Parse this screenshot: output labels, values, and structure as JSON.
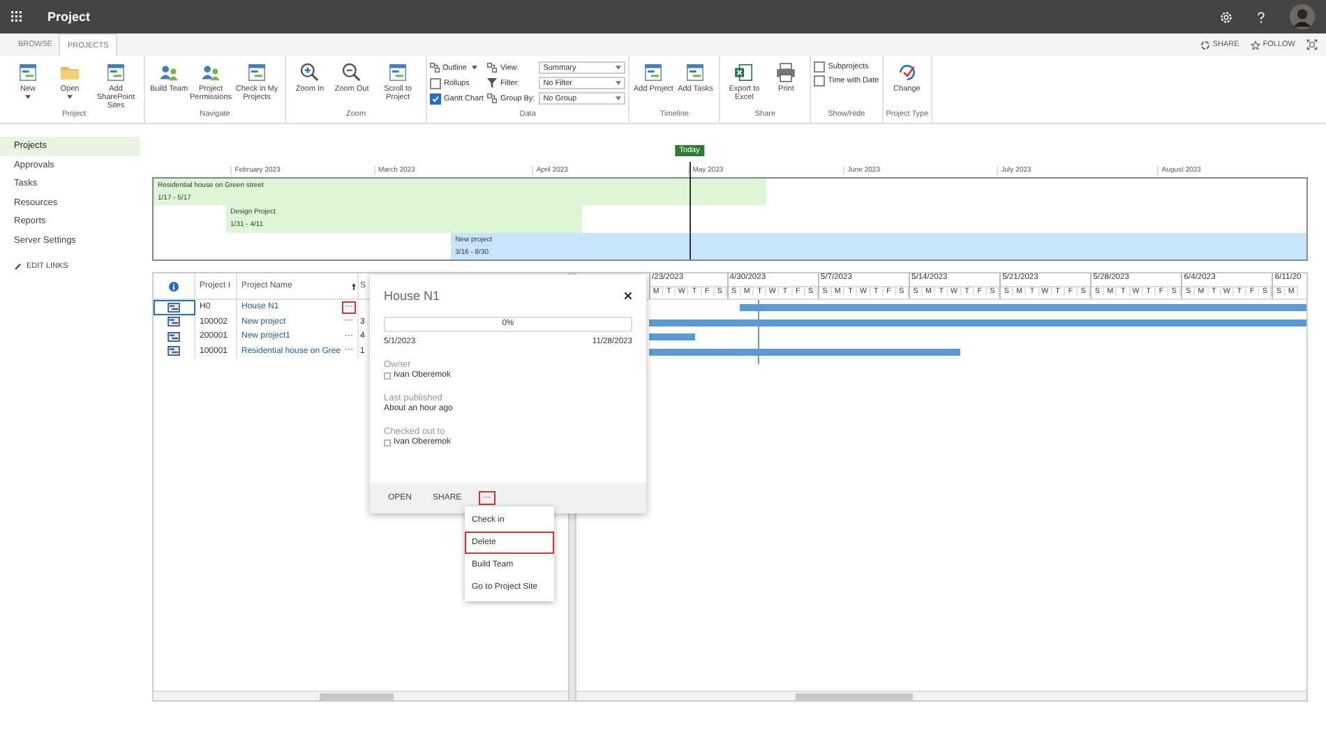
{
  "topbar": {
    "app_title": "Project"
  },
  "tabs": [
    {
      "label": "BROWSE",
      "selected": false
    },
    {
      "label": "PROJECTS",
      "selected": true
    }
  ],
  "page_actions": [
    {
      "label": "SHARE"
    },
    {
      "label": "FOLLOW"
    }
  ],
  "ribbon": {
    "groups": [
      {
        "label": "Project",
        "items": [
          {
            "kind": "large",
            "label": "New",
            "dropdown": true
          },
          {
            "kind": "large",
            "label": "Open",
            "dropdown": true
          },
          {
            "kind": "large",
            "label": "Add SharePoint Sites",
            "dropdown": false
          }
        ]
      },
      {
        "label": "Navigate",
        "items": [
          {
            "kind": "large",
            "label": "Build Team",
            "dropdown": false
          },
          {
            "kind": "large",
            "label": "Project Permissions",
            "dropdown": false
          },
          {
            "kind": "large",
            "label": "Check in My Projects",
            "dropdown": false
          }
        ]
      },
      {
        "label": "Zoom",
        "items": [
          {
            "kind": "large",
            "label": "Zoom In",
            "dropdown": false
          },
          {
            "kind": "large",
            "label": "Zoom Out",
            "dropdown": false
          },
          {
            "kind": "large",
            "label": "Scroll to Project",
            "dropdown": false
          }
        ]
      },
      {
        "label": "Data",
        "rows": [
          [
            {
              "kind": "small",
              "label": "Outline",
              "dropdown": true
            },
            {
              "kind": "small",
              "label": "View:",
              "dropdown": false
            },
            {
              "kind": "select",
              "value": "Summary"
            }
          ],
          [
            {
              "kind": "check",
              "label": "Rollups",
              "checked": false
            },
            {
              "kind": "small",
              "label": "Filter:",
              "dropdown": false
            },
            {
              "kind": "select",
              "value": "No Filter"
            }
          ],
          [
            {
              "kind": "check",
              "label": "Gantt Chart",
              "checked": true
            },
            {
              "kind": "small",
              "label": "Group By:",
              "dropdown": false
            },
            {
              "kind": "select",
              "value": "No Group"
            }
          ]
        ]
      },
      {
        "label": "Timeline",
        "items": [
          {
            "kind": "large",
            "label": "Add Project",
            "dropdown": false
          },
          {
            "kind": "large",
            "label": "Add Tasks",
            "dropdown": false
          }
        ]
      },
      {
        "label": "Share",
        "items": [
          {
            "kind": "large",
            "label": "Export to Excel",
            "dropdown": false
          },
          {
            "kind": "large",
            "label": "Print",
            "dropdown": false
          }
        ]
      },
      {
        "label": "Show/Hide",
        "rows": [
          [
            {
              "kind": "check",
              "label": "Subprojects",
              "checked": false
            }
          ],
          [
            {
              "kind": "check",
              "label": "Time with Date",
              "checked": false
            }
          ]
        ]
      },
      {
        "label": "Project Type",
        "items": [
          {
            "kind": "large",
            "label": "Change",
            "dropdown": false
          }
        ]
      }
    ]
  },
  "nav": {
    "items": [
      {
        "label": "Projects",
        "selected": true
      },
      {
        "label": "Approvals",
        "selected": false
      },
      {
        "label": "Tasks",
        "selected": false
      },
      {
        "label": "Resources",
        "selected": false
      },
      {
        "label": "Reports",
        "selected": false
      },
      {
        "label": "Server Settings",
        "selected": false
      }
    ],
    "edit_links": "EDIT LINKS"
  },
  "timeline": {
    "today_label": "Today",
    "months": [
      "February 2023",
      "March 2023",
      "April 2023",
      "May 2023",
      "June 2023",
      "July 2023",
      "August 2023"
    ],
    "bars": [
      {
        "name": "Residential house on Green street",
        "dates": "1/17 - 5/17",
        "color": "#dff6d6"
      },
      {
        "name": "Design Project",
        "dates": "1/31 - 4/11",
        "color": "#dff6d6"
      },
      {
        "name": "New project",
        "dates": "3/16 - 8/30",
        "color": "#c6e4fb"
      }
    ]
  },
  "grid": {
    "columns": [
      {
        "label": "Project I",
        "sorted": false
      },
      {
        "label": "Project Name",
        "sorted": true
      },
      {
        "label": "S",
        "sorted": false
      }
    ],
    "rows": [
      {
        "id": "H0",
        "name": "House N1",
        "more": "···",
        "highlighted": true
      },
      {
        "id": "100002",
        "name": "New project",
        "more": "···",
        "highlighted": false,
        "column_3": "3"
      },
      {
        "id": "200001",
        "name": "New project1",
        "more": "···",
        "highlighted": false,
        "column_3": "4"
      },
      {
        "id": "100001",
        "name": "Residential house on Gree",
        "more": "···",
        "highlighted": false,
        "column_3": "1"
      }
    ]
  },
  "gantt": {
    "weeks": [
      {
        "label": "/23/2023",
        "days": [
          "M",
          "T",
          "W",
          "T",
          "F",
          "S"
        ]
      },
      {
        "label": "4/30/2023",
        "days": [
          "S",
          "M",
          "T",
          "W",
          "T",
          "F",
          "S"
        ]
      },
      {
        "label": "5/7/2023",
        "days": [
          "S",
          "M",
          "T",
          "W",
          "T",
          "F",
          "S"
        ]
      },
      {
        "label": "5/14/2023",
        "days": [
          "S",
          "M",
          "T",
          "W",
          "T",
          "F",
          "S"
        ]
      },
      {
        "label": "5/21/2023",
        "days": [
          "S",
          "M",
          "T",
          "W",
          "T",
          "F",
          "S"
        ]
      },
      {
        "label": "5/28/2023",
        "days": [
          "S",
          "M",
          "T",
          "W",
          "T",
          "F",
          "S"
        ]
      },
      {
        "label": "6/4/2023",
        "days": [
          "S",
          "M",
          "T",
          "W",
          "T",
          "F",
          "S"
        ]
      },
      {
        "label": "6/11/20",
        "days": [
          "S",
          "M"
        ]
      }
    ]
  },
  "popup": {
    "title": "House N1",
    "progress": {
      "level": 0,
      "label": "0%"
    },
    "start": "5/1/2023",
    "finish": "11/28/2023",
    "fields": [
      {
        "label": "Owner",
        "value": "Ivan Oberemok",
        "kind": "person"
      },
      {
        "label": "Last published",
        "value": "About an hour ago",
        "kind": "text"
      },
      {
        "label": "Checked out to",
        "value": "Ivan Oberemok",
        "kind": "person"
      }
    ],
    "actions": [
      {
        "label": "OPEN",
        "highlighted": false
      },
      {
        "label": "SHARE",
        "highlighted": false
      },
      {
        "label": "···",
        "highlighted": true
      }
    ]
  },
  "menu": {
    "items": [
      {
        "label": "Check in",
        "highlighted": false
      },
      {
        "label": "Delete",
        "highlighted": true
      },
      {
        "label": "Build Team",
        "highlighted": false
      },
      {
        "label": "Go to Project Site",
        "highlighted": false
      }
    ]
  }
}
